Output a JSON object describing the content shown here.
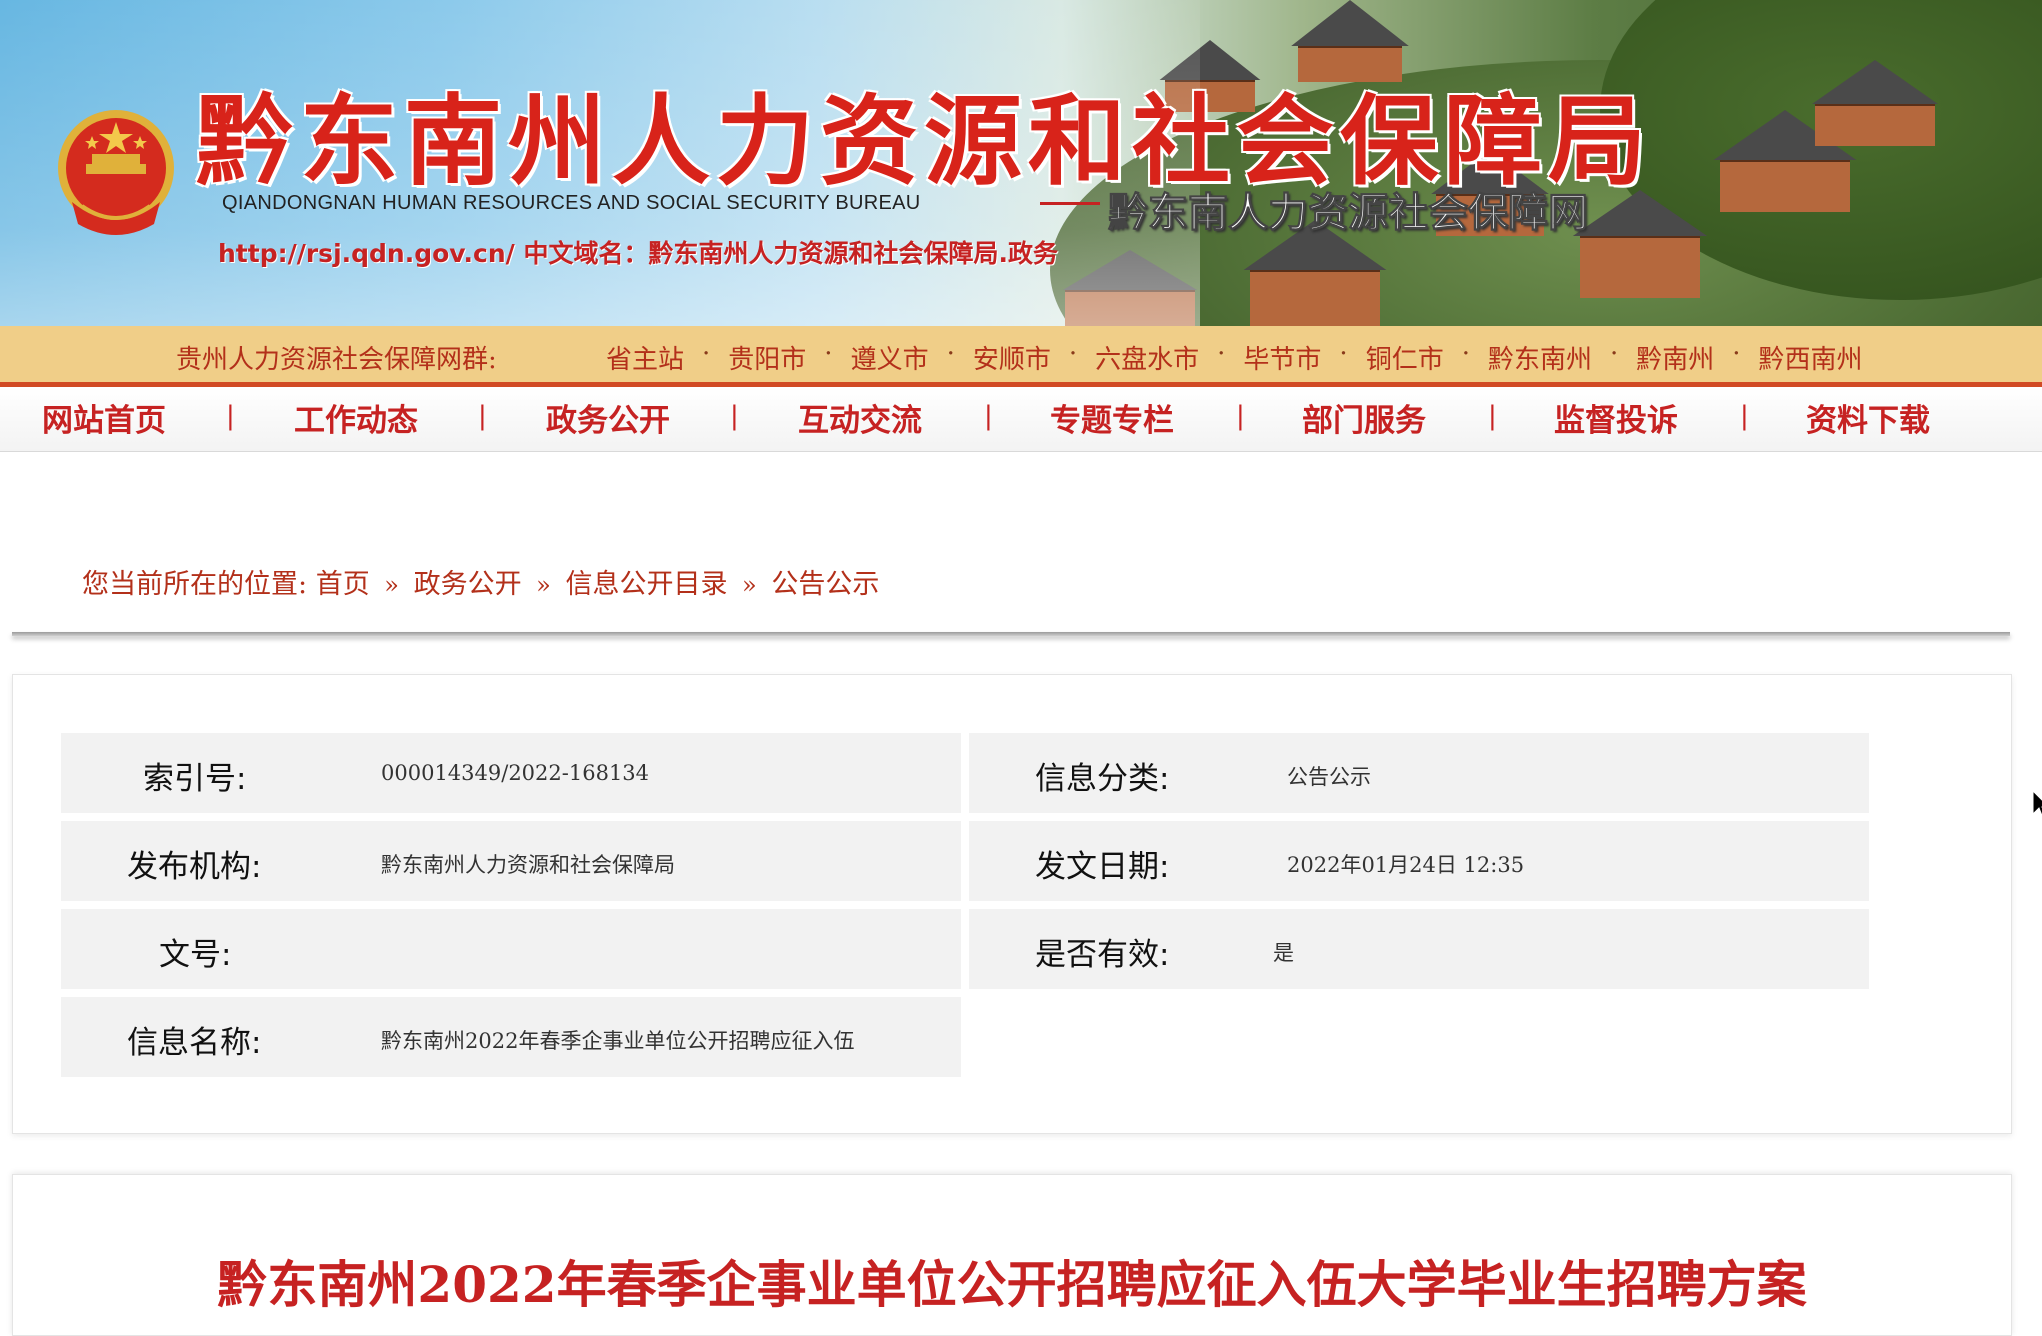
{
  "header": {
    "title": "黔东南州人力资源和社会保障局",
    "subtitle_en": "QIANDONGNAN HUMAN RESOURCES AND SOCIAL SECURITY BUREAU",
    "url_line": "http://rsj.qdn.gov.cn/   中文域名：黔东南州人力资源和社会保障局.政务",
    "network_name": "黔东南人力资源社会保障网"
  },
  "site_group": {
    "label": "贵州人力资源社会保障网群:",
    "items": [
      "省主站",
      "贵阳市",
      "遵义市",
      "安顺市",
      "六盘水市",
      "毕节市",
      "铜仁市",
      "黔东南州",
      "黔南州",
      "黔西南州"
    ],
    "separator": "·"
  },
  "nav": {
    "items": [
      "网站首页",
      "工作动态",
      "政务公开",
      "互动交流",
      "专题专栏",
      "部门服务",
      "监督投诉",
      "资料下载"
    ],
    "separator": "|"
  },
  "breadcrumb": {
    "prefix": "您当前所在的位置:",
    "items": [
      "首页",
      "政务公开",
      "信息公开目录",
      "公告公示"
    ],
    "separator": "»"
  },
  "meta": {
    "index_label": "索引号:",
    "index_value": "000014349/2022-168134",
    "category_label": "信息分类:",
    "category_value": "公告公示",
    "publisher_label": "发布机构:",
    "publisher_value": "黔东南州人力资源和社会保障局",
    "date_label": "发文日期:",
    "date_value": "2022年01月24日 12:35",
    "docno_label": "文号:",
    "docno_value": "",
    "valid_label": "是否有效:",
    "valid_value": "是",
    "name_label": "信息名称:",
    "name_value": "黔东南州2022年春季企事业单位公开招聘应征入伍"
  },
  "article": {
    "title": "黔东南州2022年春季企事业单位公开招聘应征入伍大学毕业生招聘方案"
  },
  "colors": {
    "brand_red": "#c62222",
    "group_bar_bg": "#f0ce88",
    "meta_cell_bg": "#f2f2f2"
  }
}
